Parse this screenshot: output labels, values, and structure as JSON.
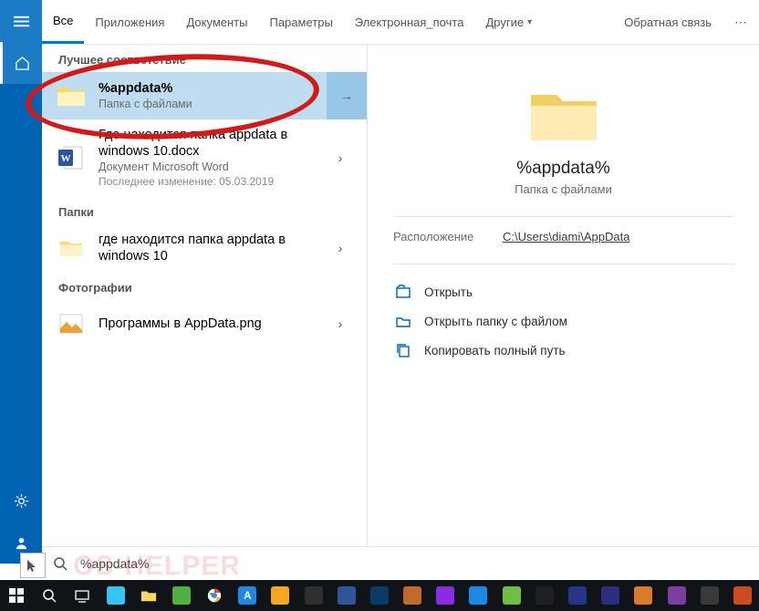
{
  "tabs": {
    "items": [
      "Все",
      "Приложения",
      "Документы",
      "Параметры",
      "Электронная_почта"
    ],
    "more": "Другие",
    "feedback": "Обратная связь"
  },
  "sections": {
    "best": "Лучшее соответствие",
    "folders": "Папки",
    "photos": "Фотографии"
  },
  "results": {
    "best": {
      "title": "%appdata%",
      "sub": "Папка с файлами"
    },
    "doc": {
      "title": "Где находится папка appdata в windows 10.docx",
      "sub": "Документ Microsoft Word",
      "meta": "Последнее изменение: 05.03.2019"
    },
    "folder": {
      "title": "где находится папка appdata в windows 10"
    },
    "photo": {
      "title": "Программы в AppData.png"
    }
  },
  "preview": {
    "title": "%appdata%",
    "sub": "Папка с файлами",
    "loc_label": "Расположение",
    "loc_value": "C:\\Users\\diami\\AppData"
  },
  "actions": {
    "open": "Открыть",
    "open_folder": "Открыть папку с файлом",
    "copy_path": "Копировать полный путь"
  },
  "search": {
    "value": "%appdata%"
  },
  "watermark": "OS-HELPER"
}
